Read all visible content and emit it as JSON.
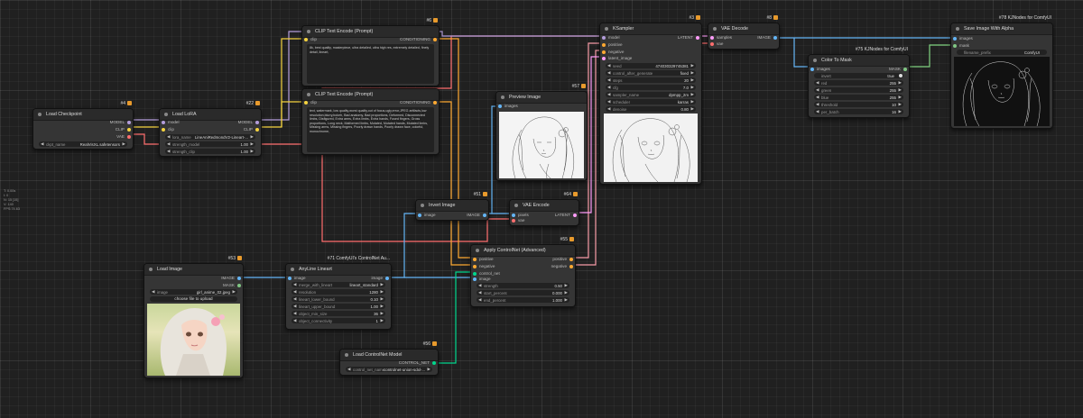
{
  "colors": {
    "model": "#b39ddb",
    "clip": "#f5d33f",
    "vae": "#ff6e6e",
    "conditioning": "#ffa931",
    "latent": "#ff9cf9",
    "image": "#64b5f6",
    "mask": "#81c784",
    "control_net": "#00d78d",
    "conditioning_wire": "#f79ba7",
    "mask_wire": "#7fd17f"
  },
  "info": [
    "T: 0.00s",
    "I: 0",
    "N: 15 [15]",
    "V: 140",
    "FPS:74.63"
  ],
  "nodes": {
    "load_checkpoint": {
      "title": "Load Checkpoint",
      "id": "#4",
      "outputs": [
        "MODEL",
        "CLIP",
        "VAE"
      ],
      "widgets": [
        {
          "label": "ckpt_name",
          "value": "RealVisXL.safetensors"
        }
      ]
    },
    "load_lora": {
      "title": "Load LoRA",
      "id": "#22",
      "inputs": [
        "model",
        "clip"
      ],
      "outputs": [
        "MODEL",
        "CLIP"
      ],
      "widgets": [
        {
          "label": "lora_name",
          "value": "LineAniRedmondV2-Lineart-..."
        },
        {
          "label": "strength_model",
          "value": "1.00"
        },
        {
          "label": "strength_clip",
          "value": "1.00"
        }
      ]
    },
    "clip_pos": {
      "title": "CLIP Text Encode (Prompt)",
      "id": "#6",
      "inputs": [
        "clip"
      ],
      "outputs": [
        "CONDITIONING"
      ],
      "text": "8k, best quality, masterpiece, ultra detailed, ultra high res, extremely detailed, finely detail, lineart,"
    },
    "clip_neg": {
      "title": "CLIP Text Encode (Prompt)",
      "id": "#7",
      "inputs": [
        "clip"
      ],
      "outputs": [
        "CONDITIONING"
      ],
      "text": "text, watermark, low quality,worst quality,out of focus,ugly,error,JPEG artifacts,low resolution,blurry,bokeh, Bad anatomy, Bad proportions, Deformed, Disconnected limbs, Disfigured, Extra arms, Extra limbs, Extra hands, Fused fingers, Gross proportions, Long neck, Malformed limbs, Mutated, Mutated hands, Mutated limbs, Missing arms, Missing fingers, Poorly drawn hands, Poorly drawn face, colorful, monochrome,"
    },
    "preview_image": {
      "title": "Preview Image",
      "id": "#57",
      "inputs": [
        "images"
      ]
    },
    "ksampler": {
      "title": "KSampler",
      "id": "#3",
      "inputs": [
        "model",
        "positive",
        "negative",
        "latent_image"
      ],
      "outputs": [
        "LATENT"
      ],
      "widgets": [
        {
          "label": "seed",
          "value": "474030329745381"
        },
        {
          "label": "control_after_generate",
          "value": "fixed"
        },
        {
          "label": "steps",
          "value": "20"
        },
        {
          "label": "cfg",
          "value": "7.0"
        },
        {
          "label": "sampler_name",
          "value": "dpmpp_2m"
        },
        {
          "label": "scheduler",
          "value": "karras"
        },
        {
          "label": "denoise",
          "value": "0.80"
        }
      ]
    },
    "vae_decode": {
      "title": "VAE Decode",
      "id": "#8",
      "inputs": [
        "samples",
        "vae"
      ],
      "outputs": [
        "IMAGE"
      ]
    },
    "color_to_mask": {
      "title": "Color To Mask",
      "id": "#75 KJNodes for ComfyUI",
      "inputs": [
        "images"
      ],
      "outputs": [
        "MASK"
      ],
      "widgets": [
        {
          "label": "invert",
          "value": "true"
        },
        {
          "label": "red",
          "value": "255"
        },
        {
          "label": "green",
          "value": "255"
        },
        {
          "label": "blue",
          "value": "255"
        },
        {
          "label": "threshold",
          "value": "10"
        },
        {
          "label": "per_batch",
          "value": "16"
        }
      ]
    },
    "save_alpha": {
      "title": "Save Image With Alpha",
      "id": "#78 KJNodes for ComfyUI",
      "inputs": [
        "images",
        "mask"
      ],
      "widgets": [
        {
          "label": "filename_prefix",
          "value": "ComfyUI"
        }
      ]
    },
    "invert_image": {
      "title": "Invert Image",
      "id": "#51",
      "inputs": [
        "image"
      ],
      "outputs": [
        "IMAGE"
      ]
    },
    "vae_encode": {
      "title": "VAE Encode",
      "id": "#64",
      "inputs": [
        "pixels",
        "vae"
      ],
      "outputs": [
        "LATENT"
      ]
    },
    "apply_controlnet": {
      "title": "Apply ControlNet (Advanced)",
      "id": "#55",
      "inputs": [
        "positive",
        "negative",
        "control_net",
        "image"
      ],
      "outputs": [
        "positive",
        "negative"
      ],
      "widgets": [
        {
          "label": "strength",
          "value": "0.50"
        },
        {
          "label": "start_percent",
          "value": "0.000"
        },
        {
          "label": "end_percent",
          "value": "1.000"
        }
      ]
    },
    "load_image": {
      "title": "Load Image",
      "id": "#53",
      "outputs": [
        "IMAGE",
        "MASK"
      ],
      "widgets": [
        {
          "label": "image",
          "value": "girl_anime_02.jpeg"
        }
      ],
      "upload": "choose file to upload"
    },
    "anyline": {
      "title": "AnyLine Lineart",
      "id": "#71 ComfyUI's ControlNet Au...",
      "inputs": [
        "image"
      ],
      "outputs": [
        "image"
      ],
      "widgets": [
        {
          "label": "merge_with_lineart",
          "value": "lineart_standard"
        },
        {
          "label": "resolution",
          "value": "1280"
        },
        {
          "label": "lineart_lower_bound",
          "value": "0.10"
        },
        {
          "label": "lineart_upper_bound",
          "value": "1.00"
        },
        {
          "label": "object_min_size",
          "value": "36"
        },
        {
          "label": "object_connectivity",
          "value": "1"
        }
      ]
    },
    "load_controlnet": {
      "title": "Load ControlNet Model",
      "id": "#56",
      "outputs": [
        "CONTROL_NET"
      ],
      "widgets": [
        {
          "label": "control_net_name",
          "value": "controlnet-union-sdxl-..."
        }
      ]
    }
  }
}
